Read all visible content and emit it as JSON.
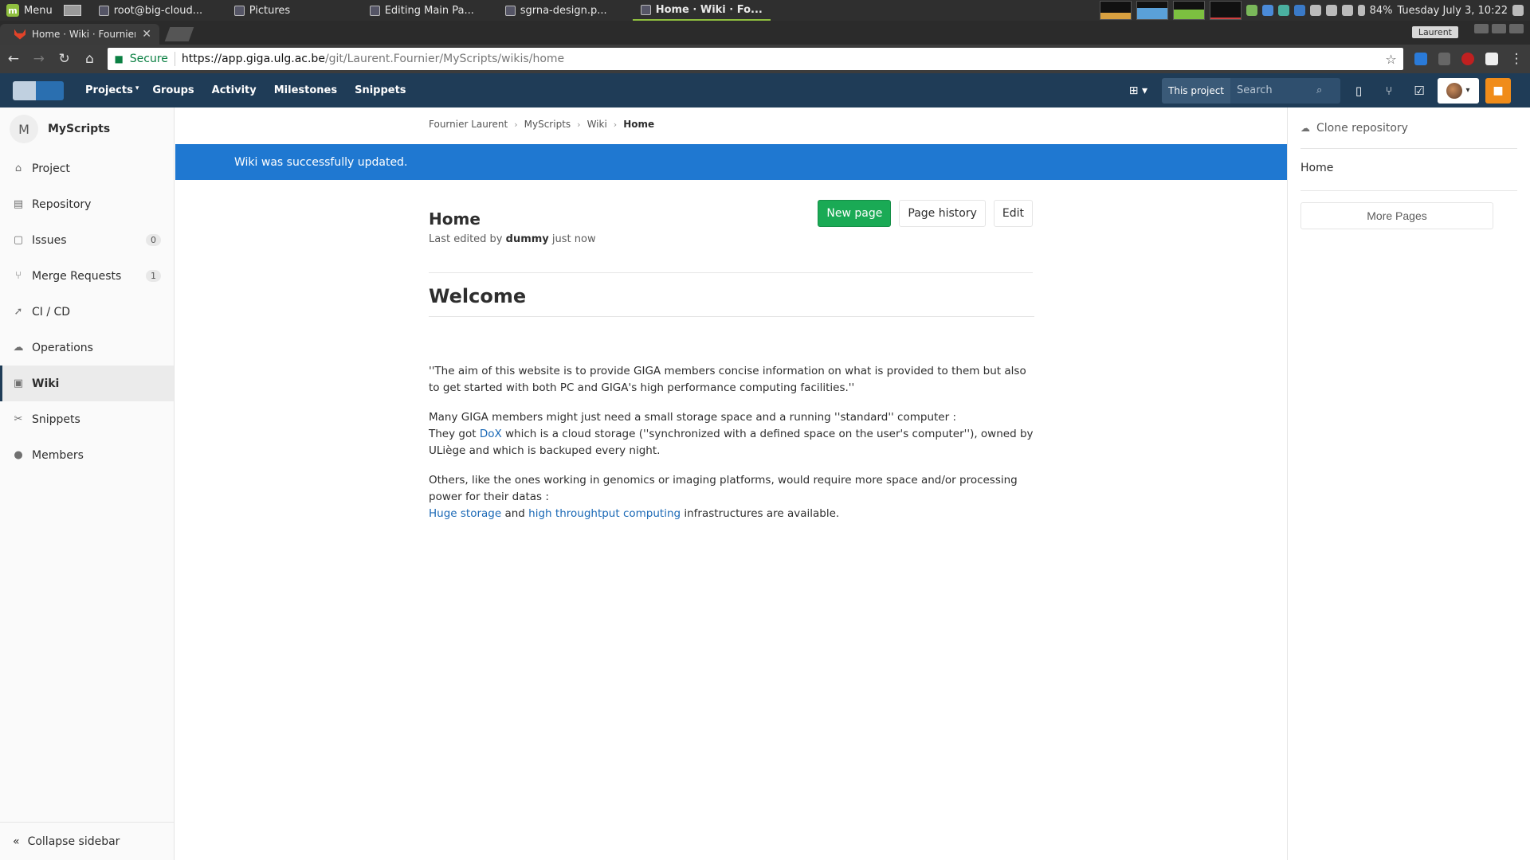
{
  "taskbar": {
    "menu_label": "Menu",
    "tasks": [
      {
        "label": "root@big-cloud..."
      },
      {
        "label": "Pictures"
      },
      {
        "label": "Editing Main Pa..."
      },
      {
        "label": "sgrna-design.p..."
      },
      {
        "label": "Home · Wiki · Fo..."
      }
    ],
    "battery": "84%",
    "datetime": "Tuesday July  3, 10:22"
  },
  "browser": {
    "tab_title": "Home · Wiki · Fournier L",
    "profile": "Laurent",
    "secure_label": "Secure",
    "url_host": "https://app.giga.ulg.ac.be",
    "url_path": "/git/Laurent.Fournier/MyScripts/wikis/home"
  },
  "header": {
    "nav": [
      "Projects",
      "Groups",
      "Activity",
      "Milestones",
      "Snippets"
    ],
    "scope": "This project",
    "search_placeholder": "Search"
  },
  "sidebar": {
    "project_initial": "M",
    "project_name": "MyScripts",
    "items": [
      {
        "label": "Project",
        "icon": "home-icon"
      },
      {
        "label": "Repository",
        "icon": "book-icon"
      },
      {
        "label": "Issues",
        "icon": "issues-icon",
        "badge": "0"
      },
      {
        "label": "Merge Requests",
        "icon": "merge-request-icon",
        "badge": "1"
      },
      {
        "label": "CI / CD",
        "icon": "rocket-icon"
      },
      {
        "label": "Operations",
        "icon": "cloud-gear-icon"
      },
      {
        "label": "Wiki",
        "icon": "wiki-icon",
        "active": true
      },
      {
        "label": "Snippets",
        "icon": "scissors-icon"
      },
      {
        "label": "Members",
        "icon": "user-icon"
      }
    ],
    "collapse_label": "Collapse sidebar"
  },
  "breadcrumb": [
    "Fournier Laurent",
    "MyScripts",
    "Wiki",
    "Home"
  ],
  "flash": "Wiki was successfully updated.",
  "wiki": {
    "title": "Home",
    "meta_prefix": "Last edited by",
    "meta_user": "dummy",
    "meta_suffix": "just now",
    "buttons": {
      "new_page": "New page",
      "history": "Page history",
      "edit": "Edit"
    },
    "heading": "Welcome",
    "p1": "''The aim of this website is to provide GIGA members concise information on what is provided to them but also to get started with both PC and GIGA's high performance computing facilities.''",
    "p2_line1": "Many GIGA members might just need a small storage space and a running ''standard'' computer :",
    "p2_pre": "They got",
    "p2_link": "DoX",
    "p2_post": "which is a cloud storage (''synchronized with a defined space on the user's computer''), owned by ULiège and which is backuped every night.",
    "p3_line1": "Others, like the ones working in genomics or imaging platforms, would require more space and/or processing power for their datas :",
    "p3_link1": "Huge storage",
    "p3_mid": "and",
    "p3_link2": "high throughtput computing",
    "p3_post": "infrastructures are available."
  },
  "right_sidebar": {
    "clone_label": "Clone repository",
    "pages": [
      "Home"
    ],
    "more_pages": "More Pages"
  }
}
